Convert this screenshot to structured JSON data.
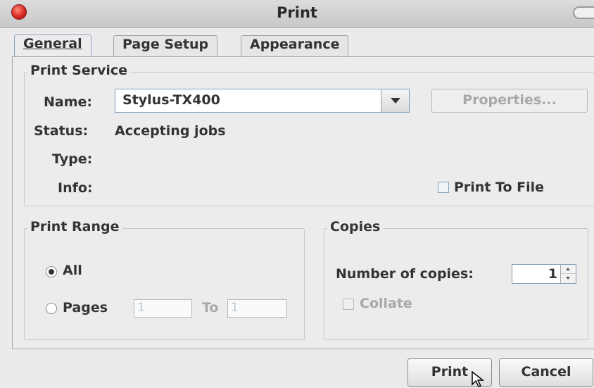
{
  "window": {
    "title": "Print"
  },
  "tabs": [
    {
      "label": "General"
    },
    {
      "label": "Page Setup"
    },
    {
      "label": "Appearance"
    }
  ],
  "print_service": {
    "legend": "Print Service",
    "name_label": "Name:",
    "name_value": "Stylus-TX400",
    "properties_button": "Properties...",
    "status_label": "Status:",
    "status_value": "Accepting jobs",
    "type_label": "Type:",
    "info_label": "Info:",
    "print_to_file": "Print To File"
  },
  "print_range": {
    "legend": "Print Range",
    "all_label": "All",
    "pages_label": "Pages",
    "from_value": "1",
    "to_label": "To",
    "to_value": "1"
  },
  "copies": {
    "legend": "Copies",
    "number_label": "Number of copies:",
    "number_value": "1",
    "collate_label": "Collate"
  },
  "buttons": {
    "print": "Print",
    "cancel": "Cancel"
  }
}
